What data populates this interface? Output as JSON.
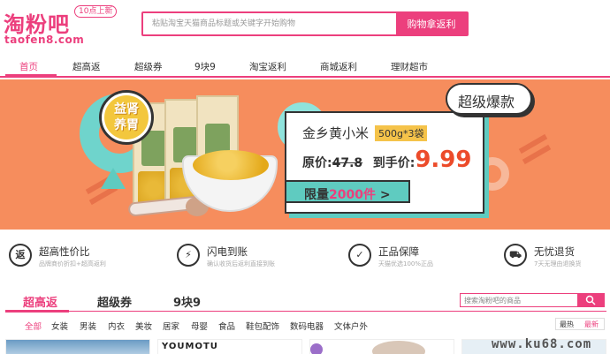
{
  "header": {
    "logo_main": "淘粉吧",
    "logo_sub": "taofen8.com",
    "logo_tag": "10点上新",
    "search_placeholder": "粘贴淘宝天猫商品标题或关键字开始购物",
    "search_button": "购物拿返利"
  },
  "nav": {
    "items": [
      {
        "label": "首页",
        "active": true
      },
      {
        "label": "超高返"
      },
      {
        "label": "超级券"
      },
      {
        "label": "9块9"
      },
      {
        "label": "淘宝返利"
      },
      {
        "label": "商城返利"
      },
      {
        "label": "理财超市"
      }
    ]
  },
  "banner": {
    "badge_line1": "益肾",
    "badge_line2": "养胃",
    "burst": "超级爆款",
    "product_title": "金乡黄小米",
    "product_spec": "500g*3袋",
    "original_label": "原价:",
    "original_price": "47.8",
    "now_label": "到手价:",
    "now_price": "9.99",
    "limit_prefix": "限量",
    "limit_num": "2000件",
    "limit_suffix": ">"
  },
  "features": [
    {
      "icon": "返",
      "title": "超高性价比",
      "desc": "品牌商价折扣+超高返利"
    },
    {
      "icon": "⚡",
      "title": "闪电到账",
      "desc": "确认收货后返利直接到账"
    },
    {
      "icon": "✓",
      "title": "正品保障",
      "desc": "天猫优选100%正品"
    },
    {
      "icon": "⛟",
      "title": "无忧退货",
      "desc": "7天无理由退换货"
    }
  ],
  "tabs": [
    {
      "label": "超高返",
      "active": true
    },
    {
      "label": "超级券"
    },
    {
      "label": "9块9"
    }
  ],
  "mini_search_placeholder": "搜索淘粉吧的商品",
  "categories": [
    {
      "label": "全部",
      "active": true
    },
    {
      "label": "女装"
    },
    {
      "label": "男装"
    },
    {
      "label": "内衣"
    },
    {
      "label": "美妆"
    },
    {
      "label": "居家"
    },
    {
      "label": "母婴"
    },
    {
      "label": "食品"
    },
    {
      "label": "鞋包配饰"
    },
    {
      "label": "数码电器"
    },
    {
      "label": "文体户外"
    }
  ],
  "sort": {
    "hot": "最热",
    "new": "最新"
  },
  "products": {
    "brand2": "YOUMOTU",
    "p3_letter": "M"
  },
  "watermark": "www.ku68.com",
  "colors": {
    "brand": "#ec3f7d",
    "banner_bg": "#f68d5d",
    "teal": "#5fcbc0",
    "price": "#ec4b2a"
  }
}
